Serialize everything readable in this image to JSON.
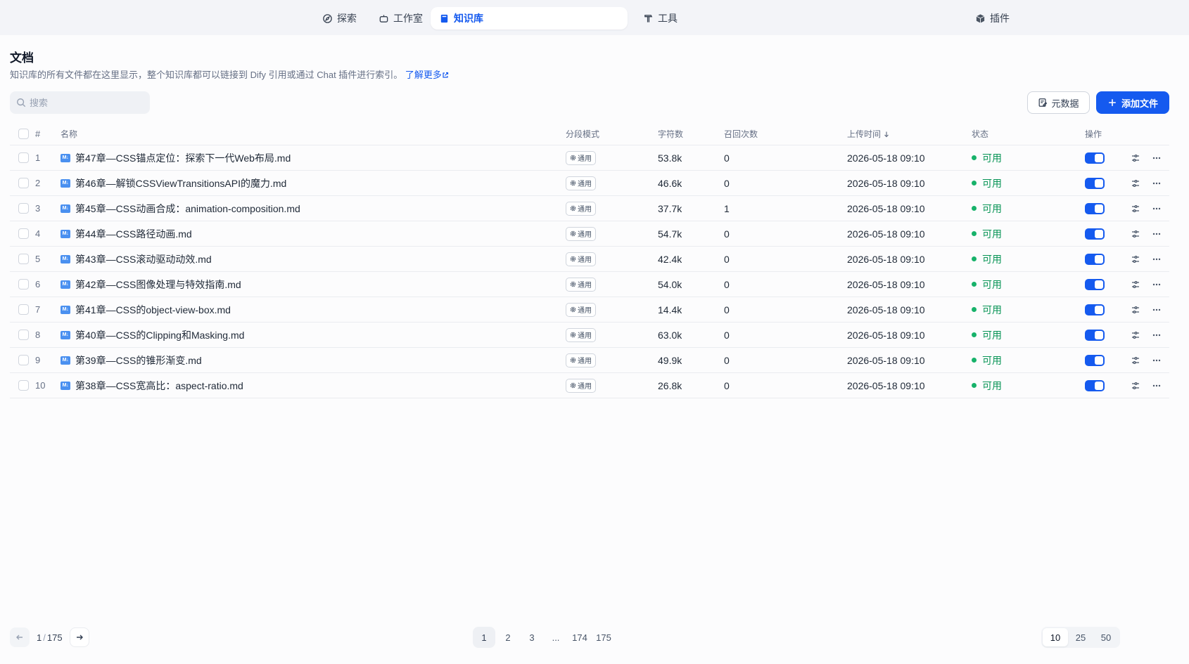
{
  "nav": {
    "items": [
      {
        "label": "探索",
        "icon": "compass-icon"
      },
      {
        "label": "工作室",
        "icon": "robot-icon"
      },
      {
        "label": "知识库",
        "icon": "book-icon",
        "active": true
      },
      {
        "label": "工具",
        "icon": "hammer-icon"
      }
    ],
    "plugins_label": "插件"
  },
  "header": {
    "title": "文档",
    "description": "知识库的所有文件都在这里显示，整个知识库都可以链接到 Dify 引用或通过 Chat 插件进行索引。",
    "learn_more": "了解更多"
  },
  "toolbar": {
    "search_placeholder": "搜索",
    "metadata_label": "元数据",
    "add_file_label": "添加文件"
  },
  "table": {
    "columns": {
      "num": "#",
      "name": "名称",
      "mode": "分段模式",
      "chars": "字符数",
      "hits": "召回次数",
      "time": "上传时间",
      "status": "状态",
      "ops": "操作"
    },
    "rows": [
      {
        "num": "1",
        "name": "第47章—CSS锚点定位：探索下一代Web布局.md",
        "mode": "通用",
        "chars": "53.8k",
        "hits": "0",
        "time": "2026-05-18 09:10",
        "status": "可用"
      },
      {
        "num": "2",
        "name": "第46章—解锁CSSViewTransitionsAPI的魔力.md",
        "mode": "通用",
        "chars": "46.6k",
        "hits": "0",
        "time": "2026-05-18 09:10",
        "status": "可用"
      },
      {
        "num": "3",
        "name": "第45章—CSS动画合成：animation-composition.md",
        "mode": "通用",
        "chars": "37.7k",
        "hits": "1",
        "time": "2026-05-18 09:10",
        "status": "可用"
      },
      {
        "num": "4",
        "name": "第44章—CSS路径动画.md",
        "mode": "通用",
        "chars": "54.7k",
        "hits": "0",
        "time": "2026-05-18 09:10",
        "status": "可用"
      },
      {
        "num": "5",
        "name": "第43章—CSS滚动驱动动效.md",
        "mode": "通用",
        "chars": "42.4k",
        "hits": "0",
        "time": "2026-05-18 09:10",
        "status": "可用"
      },
      {
        "num": "6",
        "name": "第42章—CSS图像处理与特效指南.md",
        "mode": "通用",
        "chars": "54.0k",
        "hits": "0",
        "time": "2026-05-18 09:10",
        "status": "可用"
      },
      {
        "num": "7",
        "name": "第41章—CSS的object-view-box.md",
        "mode": "通用",
        "chars": "14.4k",
        "hits": "0",
        "time": "2026-05-18 09:10",
        "status": "可用"
      },
      {
        "num": "8",
        "name": "第40章—CSS的Clipping和Masking.md",
        "mode": "通用",
        "chars": "63.0k",
        "hits": "0",
        "time": "2026-05-18 09:10",
        "status": "可用"
      },
      {
        "num": "9",
        "name": "第39章—CSS的锥形渐变.md",
        "mode": "通用",
        "chars": "49.9k",
        "hits": "0",
        "time": "2026-05-18 09:10",
        "status": "可用"
      },
      {
        "num": "10",
        "name": "第38章—CSS宽高比：aspect-ratio.md",
        "mode": "通用",
        "chars": "26.8k",
        "hits": "0",
        "time": "2026-05-18 09:10",
        "status": "可用"
      }
    ]
  },
  "pagination": {
    "current": "1",
    "total": "175",
    "pages": [
      "1",
      "2",
      "3",
      "...",
      "174",
      "175"
    ],
    "sizes": [
      "10",
      "25",
      "50"
    ],
    "active_size": "10"
  },
  "colors": {
    "accent": "#155aef",
    "status_ok": "#17b26a"
  }
}
